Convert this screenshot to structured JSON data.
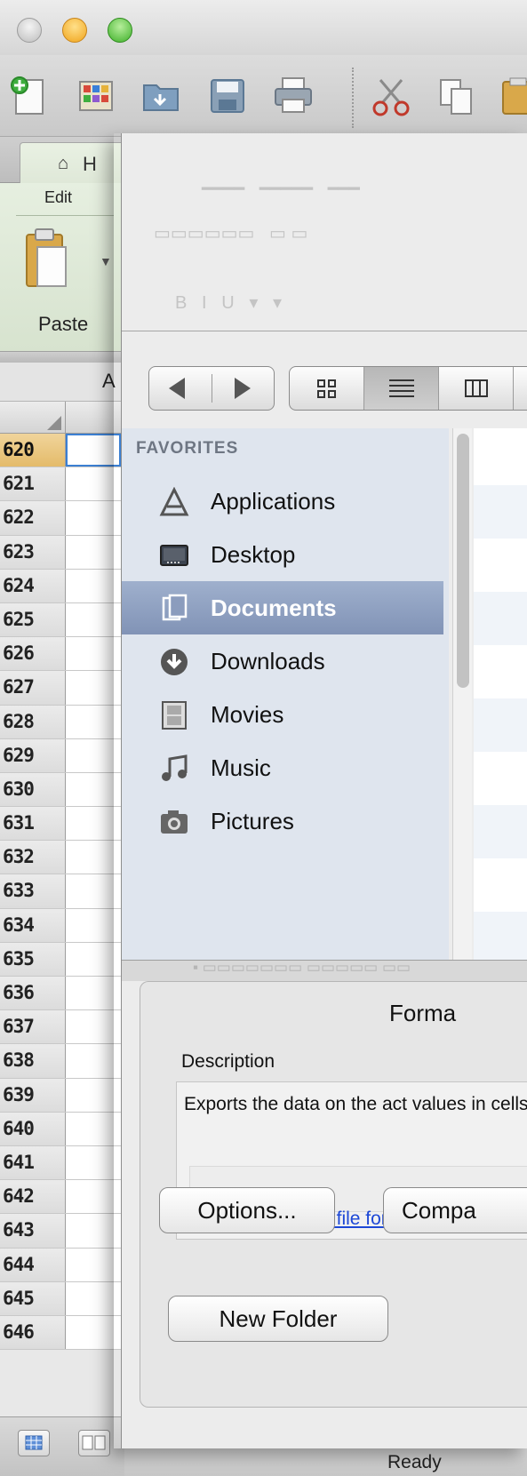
{
  "excel": {
    "ribbon": {
      "home_tab_partial": "H",
      "edit_group": "Edit",
      "paste_label": "Paste"
    },
    "name_box_partial": "A",
    "rows": [
      "620",
      "621",
      "622",
      "623",
      "624",
      "625",
      "626",
      "627",
      "628",
      "629",
      "630",
      "631",
      "632",
      "633",
      "634",
      "635",
      "636",
      "637",
      "638",
      "639",
      "640",
      "641",
      "642",
      "643",
      "644",
      "645",
      "646"
    ],
    "status": "Ready"
  },
  "save_sheet": {
    "sidebar": {
      "section": "FAVORITES",
      "items": [
        {
          "label": "Applications",
          "icon": "applications-icon"
        },
        {
          "label": "Desktop",
          "icon": "desktop-icon"
        },
        {
          "label": "Documents",
          "icon": "documents-icon",
          "selected": true
        },
        {
          "label": "Downloads",
          "icon": "downloads-icon"
        },
        {
          "label": "Movies",
          "icon": "movies-icon"
        },
        {
          "label": "Music",
          "icon": "music-icon"
        },
        {
          "label": "Pictures",
          "icon": "pictures-icon"
        }
      ]
    },
    "options": {
      "format_label": "Forma",
      "description_label": "Description",
      "description_text": "Exports the data on the act values in cells.",
      "learn_more": "Learn more about file form",
      "options_button": "Options...",
      "compat_button": "Compa"
    },
    "new_folder_button": "New Folder"
  },
  "colors": {
    "selection_blue": "#3b7fd2",
    "sidebar_selected": "#8b9cbd",
    "link": "#1c47d6"
  }
}
